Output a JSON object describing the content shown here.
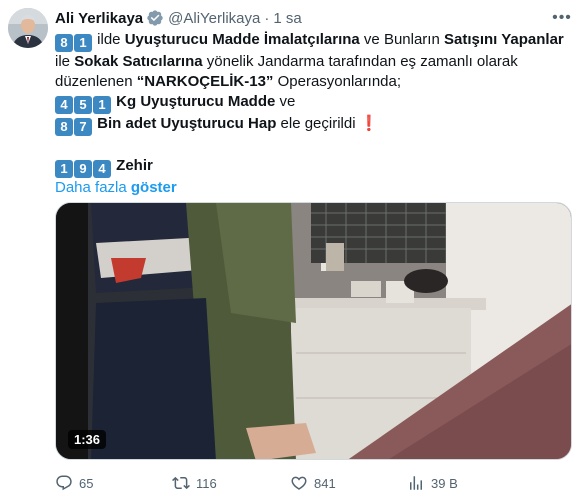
{
  "author": {
    "display_name": "Ali Yerlikaya",
    "handle": "@AliYerlikaya",
    "separator": "·",
    "time": "1 sa",
    "verified_icon": "verified-badge-icon",
    "avatar": "avatar-photo"
  },
  "tweet": {
    "line1": {
      "k1": "8",
      "k2": "1",
      "t1": " ilde ",
      "b1": "Uyuşturucu Madde İmalatçılarına",
      "t2": " ve Bunların ",
      "b2": "Satışını Yapanlar"
    },
    "line2": {
      "t1": "ile ",
      "b1": "Sokak Satıcılarına",
      "t2": " yönelik Jandarma tarafından eş zamanlı olarak"
    },
    "line3": {
      "t1": "düzenlenen ",
      "b1": "“NARKOÇELİK-13”",
      "t2": " Operasyonlarında;"
    },
    "line4": {
      "k1": "4",
      "k2": "5",
      "k3": "1",
      "b1": " Kg Uyuşturucu Madde",
      "t1": " ve"
    },
    "line5": {
      "k1": "8",
      "k2": "7",
      "b1": " Bin adet Uyuşturucu Hap",
      "t1": " ele geçirildi ",
      "mark": "❗"
    },
    "line6": {
      "k1": "1",
      "k2": "9",
      "k3": "4",
      "b1": " Zehir"
    },
    "show_more": {
      "prefix": "Daha fazla ",
      "bold": "göster"
    }
  },
  "media": {
    "type": "video",
    "duration": "1:36"
  },
  "actions": {
    "reply": {
      "icon": "reply-icon",
      "count": "65"
    },
    "retweet": {
      "icon": "retweet-icon",
      "count": "116"
    },
    "like": {
      "icon": "heart-icon",
      "count": "841"
    },
    "views": {
      "icon": "views-chart-icon",
      "count": "39 B"
    }
  },
  "colors": {
    "accent": "#1d9bf0",
    "keycap": "#3b88c3",
    "muted": "#536471",
    "text": "#0f1419"
  }
}
